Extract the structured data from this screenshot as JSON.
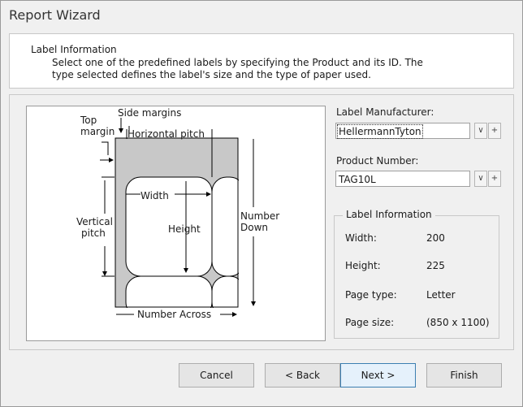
{
  "window": {
    "title": "Report Wizard"
  },
  "header": {
    "title": "Label Information",
    "description": "Select one of the predefined labels by specifying the Product and its ID. The type selected defines the label's size and the type of paper used."
  },
  "diagram": {
    "top_margin_line1": "Top",
    "top_margin_line2": "margin",
    "side_margins": "Side margins",
    "horizontal_pitch": "Horizontal pitch",
    "width": "Width",
    "height": "Height",
    "vertical_pitch_line1": "Vertical",
    "vertical_pitch_line2": "pitch",
    "number_down_line1": "Number",
    "number_down_line2": "Down",
    "number_across": "Number Across"
  },
  "manufacturer": {
    "label": "Label Manufacturer:",
    "value": "HellermannTyton"
  },
  "product": {
    "label": "Product Number:",
    "value": "TAG10L"
  },
  "info": {
    "title": "Label Information",
    "width_label": "Width:",
    "width_value": "200",
    "height_label": "Height:",
    "height_value": "225",
    "page_type_label": "Page type:",
    "page_type_value": "Letter",
    "page_size_label": "Page size:",
    "page_size_value": "(850 x 1100)"
  },
  "buttons": {
    "cancel": "Cancel",
    "back": "< Back",
    "next": "Next >",
    "finish": "Finish"
  },
  "icons": {
    "dropdown": "chevron-down-icon",
    "add": "plus-icon"
  }
}
